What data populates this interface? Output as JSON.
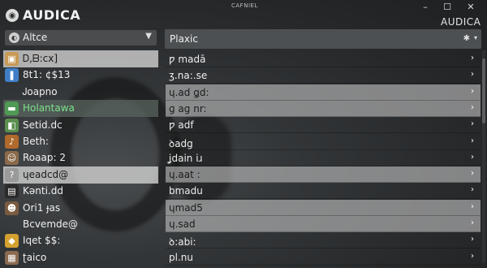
{
  "window": {
    "app_title": "AUDICA",
    "caption": "CAFNIEL",
    "sub_title": "AUDICA",
    "min_glyph": "–",
    "max_glyph": "☐",
    "close_glyph": "✕"
  },
  "left": {
    "dropdown": {
      "label": "Altce",
      "icon_glyph": "◐",
      "chevron": "▼"
    },
    "items": [
      {
        "label": "Ꭰ,ᗷ:cx]",
        "icon": "folder-icon",
        "glyph": "▣",
        "color": "#c89a55",
        "state": "selected"
      },
      {
        "label": "8t1: ¢$13",
        "icon": "bottle-icon",
        "glyph": "❚",
        "color": "#3f7ec7",
        "state": ""
      },
      {
        "label": "Ꭻoapno",
        "icon": "",
        "glyph": "",
        "color": "",
        "state": ""
      },
      {
        "label": "Holantawa",
        "icon": "cash-icon",
        "glyph": "▬",
        "color": "#4f9a55",
        "state": "highlight"
      },
      {
        "label": "Setid.dc",
        "icon": "book-icon",
        "glyph": "◧",
        "color": "#5a8f4e",
        "state": ""
      },
      {
        "label": "Beth:",
        "icon": "guitar-icon",
        "glyph": "♪",
        "color": "#b06a2c",
        "state": ""
      },
      {
        "label": "Roaap: 2",
        "icon": "character-icon",
        "glyph": "☺",
        "color": "#8a6a4a",
        "state": ""
      },
      {
        "label": "ɥeadcd@",
        "icon": "help-icon",
        "glyph": "?",
        "color": "#9a9a9a",
        "state": "selected"
      },
      {
        "label": "Kənti.dd",
        "icon": "document-icon",
        "glyph": "▤",
        "color": "#2a2a2a",
        "state": ""
      },
      {
        "label": "Ori1 ɟas",
        "icon": "portrait-icon",
        "glyph": "☻",
        "color": "#7a5a40",
        "state": ""
      },
      {
        "label": "Bcvemde@",
        "icon": "",
        "glyph": "",
        "color": "",
        "state": ""
      },
      {
        "label": "Iqet $$:",
        "icon": "gold-icon",
        "glyph": "◆",
        "color": "#d4a030",
        "state": ""
      },
      {
        "label": "ʈaico",
        "icon": "crate-icon",
        "glyph": "▦",
        "color": "#8a6a50",
        "state": ""
      }
    ]
  },
  "right": {
    "header": {
      "label": "Plaxic",
      "gear_glyph": "✱",
      "chevron": "▾"
    },
    "chevron": "›",
    "rows": [
      {
        "label": "ƿ madā",
        "state": ""
      },
      {
        "label": "ʒ.na:.se",
        "state": ""
      },
      {
        "label": "ɥ.ad ǥd:",
        "state": "selected"
      },
      {
        "label": "ɡ ag nr:",
        "state": "selected"
      },
      {
        "label": "ƿ adf",
        "state": ""
      },
      {
        "label": "ꝺadg",
        "state": ""
      },
      {
        "label": "ʝdain iɹ",
        "state": ""
      },
      {
        "label": "ɥ.aat :",
        "state": "selected"
      },
      {
        "label": "bmadu",
        "state": ""
      },
      {
        "label": "ɥmad5",
        "state": "selected"
      },
      {
        "label": "ɥ.sad",
        "state": "selected"
      },
      {
        "label": "ꝺ:abi:",
        "state": ""
      },
      {
        "label": "pl.nu",
        "state": ""
      }
    ]
  }
}
